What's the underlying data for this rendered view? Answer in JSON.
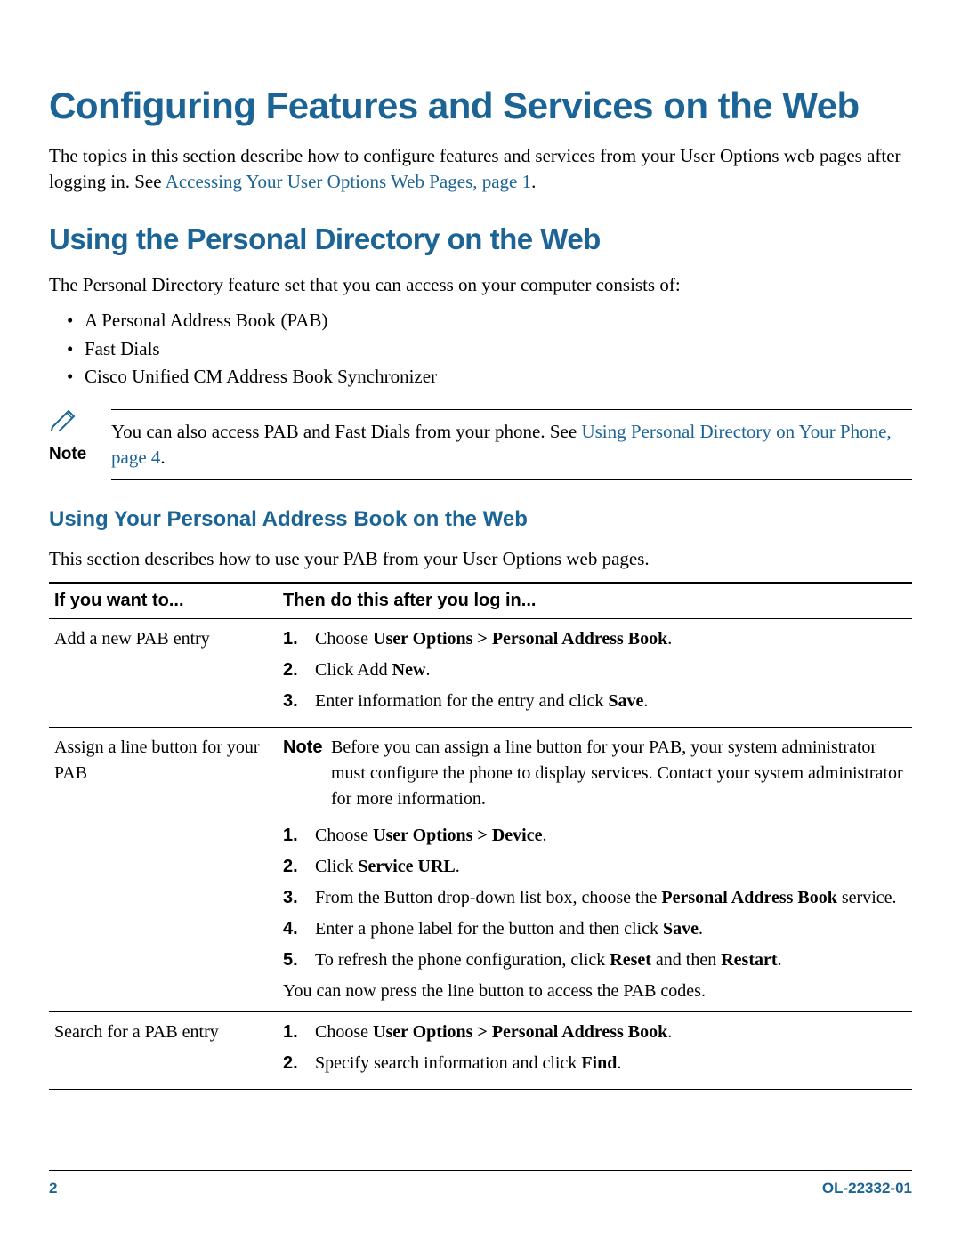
{
  "h1": "Configuring Features and Services on the Web",
  "intro_pre": "The topics in this section describe how to configure features and services from your User Options web pages after logging in. See ",
  "intro_link": "Accessing Your User Options Web Pages, page 1",
  "intro_post": ".",
  "h2": "Using the Personal Directory on the Web",
  "pd_intro": "The Personal Directory feature set that you can access on your computer consists of:",
  "bullets": [
    "A Personal Address Book (PAB)",
    "Fast Dials",
    "Cisco Unified CM Address Book Synchronizer"
  ],
  "note_label": "Note",
  "note_body_pre": "You can also access PAB and Fast Dials from your phone. See ",
  "note_body_link": "Using Personal Directory on Your Phone, page 4",
  "note_body_post": ".",
  "h3": "Using Your Personal Address Book on the Web",
  "h3_intro": "This section describes how to use your PAB from your User Options web pages.",
  "table": {
    "th_left": "If you want to...",
    "th_right": "Then do this after you log in...",
    "rows": [
      {
        "left": "Add a new PAB entry",
        "steps": [
          {
            "pre": "Choose ",
            "bold": "User Options > Personal Address Book",
            "post": "."
          },
          {
            "pre": "Click Add ",
            "bold": "New",
            "post": "."
          },
          {
            "pre": "Enter information for the entry and click ",
            "bold": "Save",
            "post": "."
          }
        ]
      },
      {
        "left": "Assign a line button for your PAB",
        "inline_note_label": "Note",
        "inline_note_body": "Before you can assign a line button for your PAB, your system administrator must configure the phone to display services. Contact your system administrator for more information.",
        "steps": [
          {
            "pre": "Choose ",
            "bold": "User Options > Device",
            "post": "."
          },
          {
            "pre": "Click ",
            "bold": "Service URL",
            "post": "."
          },
          {
            "pre": "From the Button drop-down list box, choose the ",
            "bold": "Personal Address Book",
            "post": " service."
          },
          {
            "pre": "Enter a phone label for the button and then click ",
            "bold": "Save",
            "post": "."
          },
          {
            "pre": "To refresh the phone configuration, click ",
            "bold": "Reset",
            "post": " and then ",
            "bold2": "Restart",
            "post2": "."
          }
        ],
        "after": "You can now press the line button to access the PAB codes."
      },
      {
        "left": "Search for a PAB entry",
        "steps": [
          {
            "pre": "Choose ",
            "bold": "User Options > Personal Address Book",
            "post": "."
          },
          {
            "pre": "Specify search information and click ",
            "bold": "Find",
            "post": "."
          }
        ]
      }
    ]
  },
  "footer": {
    "page": "2",
    "docid": "OL-22332-01"
  }
}
